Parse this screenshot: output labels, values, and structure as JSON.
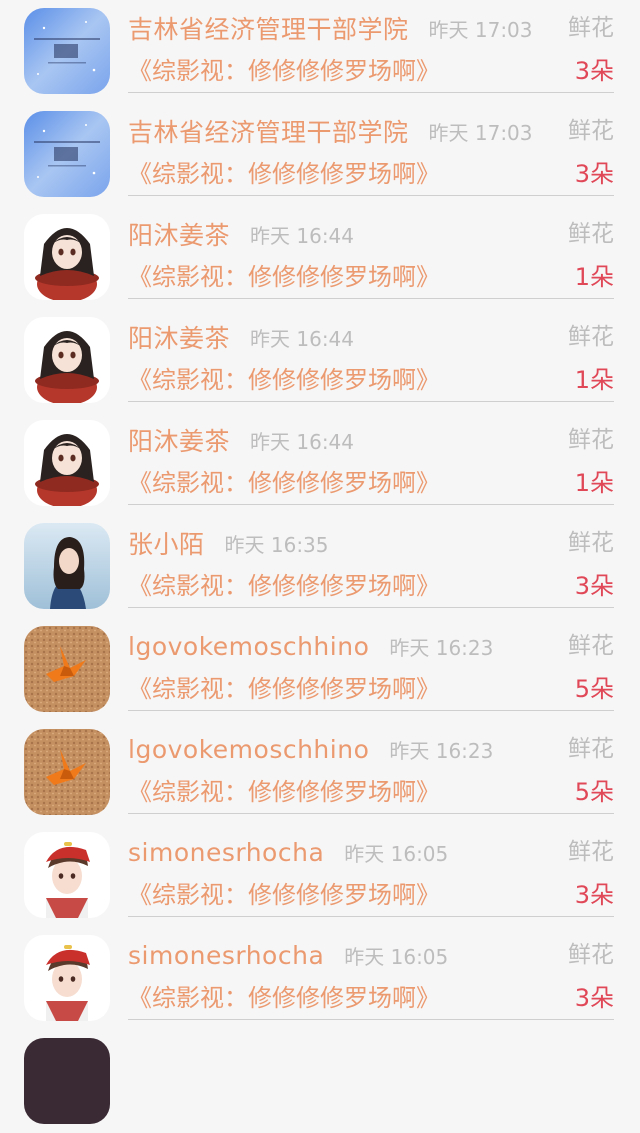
{
  "gifts": [
    {
      "name": "吉林省经济管理干部学院",
      "time": "昨天 17:03",
      "type": "鲜花",
      "title": "《综影视：修修修修罗场啊》",
      "count": "3朵",
      "avatar": "galaxy"
    },
    {
      "name": "吉林省经济管理干部学院",
      "time": "昨天 17:03",
      "type": "鲜花",
      "title": "《综影视：修修修修罗场啊》",
      "count": "3朵",
      "avatar": "galaxy"
    },
    {
      "name": "阳沐姜茶",
      "time": "昨天 16:44",
      "type": "鲜花",
      "title": "《综影视：修修修修罗场啊》",
      "count": "1朵",
      "avatar": "anime-girl"
    },
    {
      "name": "阳沐姜茶",
      "time": "昨天 16:44",
      "type": "鲜花",
      "title": "《综影视：修修修修罗场啊》",
      "count": "1朵",
      "avatar": "anime-girl"
    },
    {
      "name": "阳沐姜茶",
      "time": "昨天 16:44",
      "type": "鲜花",
      "title": "《综影视：修修修修罗场啊》",
      "count": "1朵",
      "avatar": "anime-girl"
    },
    {
      "name": "张小陌",
      "time": "昨天 16:35",
      "type": "鲜花",
      "title": "《综影视：修修修修罗场啊》",
      "count": "3朵",
      "avatar": "photo-woman"
    },
    {
      "name": "lgovokemoschhino",
      "time": "昨天 16:23",
      "type": "鲜花",
      "title": "《综影视：修修修修罗场啊》",
      "count": "5朵",
      "avatar": "paper-crane"
    },
    {
      "name": "lgovokemoschhino",
      "time": "昨天 16:23",
      "type": "鲜花",
      "title": "《综影视：修修修修罗场啊》",
      "count": "5朵",
      "avatar": "paper-crane"
    },
    {
      "name": "simonesrhocha",
      "time": "昨天 16:05",
      "type": "鲜花",
      "title": "《综影视：修修修修罗场啊》",
      "count": "3朵",
      "avatar": "anime-boy"
    },
    {
      "name": "simonesrhocha",
      "time": "昨天 16:05",
      "type": "鲜花",
      "title": "《综影视：修修修修罗场啊》",
      "count": "3朵",
      "avatar": "anime-boy"
    }
  ],
  "colors": {
    "name": "#eb9a70",
    "title": "#eb9a70",
    "count": "#e04858",
    "muted": "#bdbdbd",
    "background": "#f7f6f6",
    "divider": "#cfcfcf"
  }
}
